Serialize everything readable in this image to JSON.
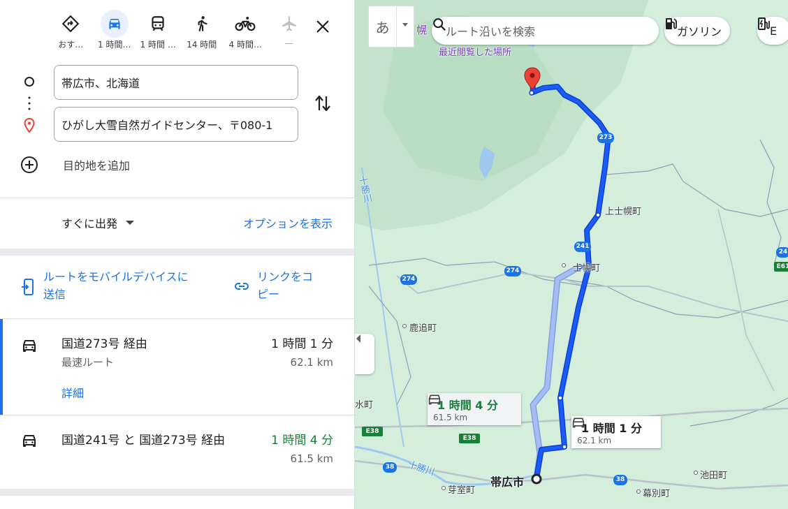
{
  "modes": [
    {
      "label": "おす…",
      "icon": "directions-icon",
      "active": false
    },
    {
      "label": "1 時間…",
      "icon": "car-icon",
      "active": true
    },
    {
      "label": "1 時間 …",
      "icon": "train-icon",
      "active": false
    },
    {
      "label": "14 時間",
      "icon": "walk-icon",
      "active": false
    },
    {
      "label": "4 時間…",
      "icon": "bicycle-icon",
      "active": false
    },
    {
      "label": "—",
      "icon": "flight-icon",
      "active": false
    }
  ],
  "origin": "帯広市、北海道",
  "destination": "ひがし大雪自然ガイドセンター、〒080-1",
  "add_destination": "目的地を追加",
  "depart_label": "すぐに出発",
  "options_label": "オプションを表示",
  "send_to_mobile": "ルートをモバイルデバイスに送信",
  "send_to_mobile_line1": "ルートをモバイルデバイスに",
  "send_to_mobile_line2": "送信",
  "copy_link_line1": "リンクをコ",
  "copy_link_line2": "ピー",
  "routes": [
    {
      "name": "国道273号 経由",
      "sub": "最速ルート",
      "detail": "詳細",
      "time": "1 時間 1 分",
      "distance": "62.1 km"
    },
    {
      "name": "国道241号 と 国道273号 経由",
      "time": "1 時間 4 分",
      "distance": "61.5 km"
    }
  ],
  "map": {
    "ime_label": "あ",
    "search_placeholder": "ルート沿いを検索",
    "chip_gas": "ガソリン",
    "chip_next": "E",
    "recent_places": "最近閲覧した場所",
    "callout_main_time": "1 時間 1 分",
    "callout_main_dist": "62.1 km",
    "callout_alt_time": "1 時間 4 分",
    "callout_alt_dist": "61.5 km",
    "places": {
      "kamishihoro": "上士幌町",
      "shihoro": "士幌町",
      "shikaoi": "鹿追町",
      "obihiro": "帯広市",
      "memuro": "芽室町",
      "ikeda": "池田町",
      "makubetsu": "幕別町",
      "shimizu": "水町",
      "horo": "幌",
      "tokachi1": "十勝川",
      "tokachi2": "十勝川"
    },
    "shields": {
      "r273": "273",
      "r241": "241",
      "r274a": "274",
      "r274b": "274",
      "r38a": "38",
      "r38b": "38",
      "r24": "24",
      "e38a": "E38",
      "e38b": "E38",
      "e61": "E61"
    }
  },
  "colors": {
    "accent": "#1a73e8",
    "route_main": "#1a5cf5",
    "route_alt": "#a5bdf3",
    "green_time": "#188038",
    "map_bg": "#d5eedc",
    "pin": "#ea4335"
  }
}
